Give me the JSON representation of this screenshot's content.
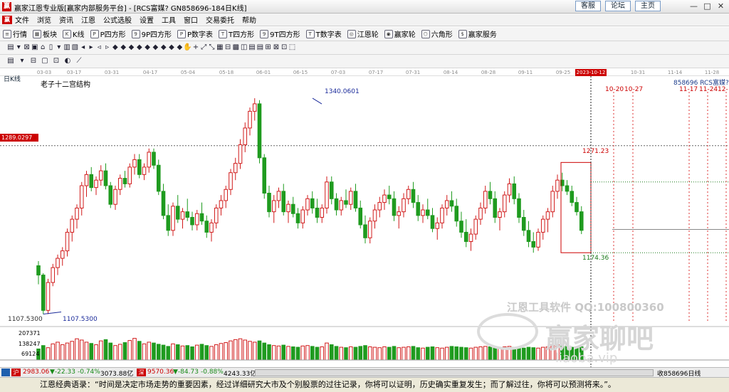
{
  "window": {
    "title": "赢家江恩专业版[赢家内部服务平台] - [RCS富媒?  GN858696-184日K线]",
    "links": [
      "客服",
      "论坛",
      "主页"
    ],
    "minimize_glyph": "—",
    "restore_glyph": "□",
    "close_glyph": "✕"
  },
  "menu": {
    "items": [
      "文件",
      "浏览",
      "资讯",
      "江恩",
      "公式选股",
      "设置",
      "工具",
      "窗口",
      "交易委托",
      "帮助"
    ]
  },
  "toolbar": {
    "items": [
      {
        "label": "行情",
        "icon": "grid-icon",
        "glyph": "≡"
      },
      {
        "label": "板块",
        "icon": "blocks-icon",
        "glyph": "▦"
      },
      {
        "label": "K线",
        "icon": "candle-icon",
        "glyph": "K"
      },
      {
        "label": "P四方形",
        "icon": "p-square-icon",
        "glyph": "P"
      },
      {
        "label": "9P四方形",
        "icon": "9p-square-icon",
        "glyph": "9"
      },
      {
        "label": "P数字表",
        "icon": "p-table-icon",
        "glyph": "P"
      },
      {
        "label": "T四方形",
        "icon": "t-square-icon",
        "glyph": "T"
      },
      {
        "label": "9T四方形",
        "icon": "9t-square-icon",
        "glyph": "9"
      },
      {
        "label": "T数字表",
        "icon": "t-table-icon",
        "glyph": "T"
      },
      {
        "label": "江恩轮",
        "icon": "gann-wheel-icon",
        "glyph": "◎"
      },
      {
        "label": "赢家轮",
        "icon": "winner-wheel-icon",
        "glyph": "◉"
      },
      {
        "label": "六角形",
        "icon": "hexagon-icon",
        "glyph": "⬡"
      },
      {
        "label": "赢家服务",
        "icon": "service-icon",
        "glyph": "$"
      }
    ],
    "row2_glyphs": [
      "▤",
      "▾",
      "⊠",
      "▣",
      "⌂",
      "▯",
      "▾",
      "▥",
      "▧",
      "◂",
      "▸",
      "◃",
      "▹",
      "◆",
      "◆",
      "◆",
      "◆",
      "◆",
      "◆",
      "◆",
      "◆",
      "◆",
      "✋",
      "+",
      "⤢",
      "⤡",
      "▦",
      "⊟",
      "▩",
      "◫",
      "▤",
      "▤",
      "⊞",
      "⊠",
      "⊡",
      "⬚"
    ],
    "row3_glyphs": [
      "▤",
      "▾",
      "⊟",
      "▢",
      "⊡",
      "◐",
      "⟋"
    ]
  },
  "date_axis": {
    "labels": [
      "03-03",
      "03-17",
      "03-31",
      "04-17",
      "05-04",
      "05-18",
      "06-01",
      "06-15",
      "07-03",
      "07-17",
      "07-31",
      "08-14",
      "08-28",
      "09-11",
      "09-25",
      "10-31",
      "11-14",
      "11-28"
    ],
    "highlight": "2023-10-12"
  },
  "chart": {
    "period_label": "日K线",
    "indicator_label": "老子十二宫结构",
    "symbol_label": "858696  RCS富媒?",
    "cursor_price": "1289.0297",
    "low_label_left": "1107.5300",
    "low_annotation": "1107.5300",
    "high_annotation": "1340.0601",
    "box_high": "1271.23",
    "box_low": "1174.36",
    "future_dates_a": [
      "10-20",
      "10-27"
    ],
    "future_dates_b": [
      "11-17",
      "11-24",
      "12-"
    ],
    "up_color": "#d11b1b",
    "down_color": "#1f9b1f"
  },
  "volume": {
    "labels": [
      "207371",
      "138247",
      "69124"
    ]
  },
  "chart_data": {
    "type": "candlestick",
    "title": "老子十二宫结构",
    "xlabel": "",
    "ylabel": "",
    "ylim": [
      1100,
      1350
    ],
    "candles": [
      [
        1160,
        1165,
        1140,
        1150
      ],
      [
        1150,
        1152,
        1108,
        1112
      ],
      [
        1112,
        1146,
        1108,
        1142
      ],
      [
        1142,
        1162,
        1138,
        1158
      ],
      [
        1158,
        1172,
        1150,
        1168
      ],
      [
        1168,
        1180,
        1160,
        1176
      ],
      [
        1176,
        1200,
        1170,
        1196
      ],
      [
        1196,
        1214,
        1186,
        1210
      ],
      [
        1210,
        1226,
        1200,
        1222
      ],
      [
        1222,
        1250,
        1214,
        1246
      ],
      [
        1246,
        1262,
        1234,
        1258
      ],
      [
        1258,
        1266,
        1240,
        1244
      ],
      [
        1244,
        1256,
        1236,
        1252
      ],
      [
        1252,
        1268,
        1246,
        1262
      ],
      [
        1262,
        1270,
        1242,
        1246
      ],
      [
        1246,
        1250,
        1222,
        1226
      ],
      [
        1226,
        1246,
        1220,
        1242
      ],
      [
        1242,
        1258,
        1236,
        1254
      ],
      [
        1254,
        1262,
        1244,
        1248
      ],
      [
        1248,
        1270,
        1244,
        1266
      ],
      [
        1266,
        1280,
        1258,
        1274
      ],
      [
        1274,
        1280,
        1254,
        1258
      ],
      [
        1258,
        1270,
        1252,
        1266
      ],
      [
        1266,
        1286,
        1260,
        1282
      ],
      [
        1282,
        1286,
        1264,
        1268
      ],
      [
        1268,
        1274,
        1236,
        1240
      ],
      [
        1240,
        1248,
        1210,
        1214
      ],
      [
        1214,
        1226,
        1192,
        1198
      ],
      [
        1198,
        1228,
        1192,
        1224
      ],
      [
        1224,
        1236,
        1206,
        1210
      ],
      [
        1210,
        1222,
        1200,
        1218
      ],
      [
        1218,
        1232,
        1208,
        1212
      ],
      [
        1212,
        1218,
        1198,
        1204
      ],
      [
        1204,
        1220,
        1198,
        1216
      ],
      [
        1216,
        1228,
        1204,
        1208
      ],
      [
        1208,
        1214,
        1190,
        1196
      ],
      [
        1196,
        1210,
        1186,
        1206
      ],
      [
        1206,
        1226,
        1200,
        1222
      ],
      [
        1222,
        1236,
        1214,
        1230
      ],
      [
        1230,
        1246,
        1222,
        1242
      ],
      [
        1242,
        1264,
        1236,
        1260
      ],
      [
        1260,
        1276,
        1252,
        1270
      ],
      [
        1270,
        1296,
        1264,
        1290
      ],
      [
        1290,
        1314,
        1282,
        1308
      ],
      [
        1308,
        1330,
        1300,
        1326
      ],
      [
        1326,
        1340,
        1316,
        1334
      ],
      [
        1334,
        1338,
        1270,
        1276
      ],
      [
        1276,
        1280,
        1232,
        1238
      ],
      [
        1238,
        1246,
        1212,
        1218
      ],
      [
        1218,
        1236,
        1206,
        1230
      ],
      [
        1230,
        1244,
        1222,
        1240
      ],
      [
        1240,
        1248,
        1214,
        1218
      ],
      [
        1218,
        1230,
        1206,
        1226
      ],
      [
        1226,
        1234,
        1212,
        1216
      ],
      [
        1216,
        1222,
        1200,
        1206
      ],
      [
        1206,
        1224,
        1200,
        1220
      ],
      [
        1220,
        1236,
        1214,
        1232
      ],
      [
        1232,
        1240,
        1216,
        1222
      ],
      [
        1222,
        1232,
        1206,
        1212
      ],
      [
        1212,
        1226,
        1206,
        1222
      ],
      [
        1222,
        1256,
        1216,
        1250
      ],
      [
        1250,
        1256,
        1226,
        1232
      ],
      [
        1232,
        1238,
        1214,
        1220
      ],
      [
        1220,
        1234,
        1214,
        1230
      ],
      [
        1230,
        1242,
        1222,
        1226
      ],
      [
        1226,
        1244,
        1220,
        1240
      ],
      [
        1240,
        1248,
        1218,
        1222
      ],
      [
        1222,
        1230,
        1200,
        1204
      ],
      [
        1204,
        1214,
        1184,
        1190
      ],
      [
        1190,
        1212,
        1184,
        1208
      ],
      [
        1208,
        1226,
        1200,
        1220
      ],
      [
        1220,
        1234,
        1212,
        1228
      ],
      [
        1228,
        1242,
        1220,
        1236
      ],
      [
        1236,
        1246,
        1226,
        1232
      ],
      [
        1232,
        1240,
        1208,
        1214
      ],
      [
        1214,
        1224,
        1200,
        1218
      ],
      [
        1218,
        1238,
        1212,
        1232
      ],
      [
        1232,
        1246,
        1226,
        1242
      ],
      [
        1242,
        1250,
        1222,
        1228
      ],
      [
        1228,
        1236,
        1208,
        1214
      ],
      [
        1214,
        1226,
        1206,
        1220
      ],
      [
        1220,
        1232,
        1210,
        1214
      ],
      [
        1214,
        1222,
        1196,
        1200
      ],
      [
        1200,
        1212,
        1188,
        1206
      ],
      [
        1206,
        1226,
        1200,
        1222
      ],
      [
        1222,
        1236,
        1214,
        1230
      ],
      [
        1230,
        1240,
        1218,
        1224
      ],
      [
        1224,
        1232,
        1202,
        1208
      ],
      [
        1208,
        1218,
        1190,
        1196
      ],
      [
        1196,
        1210,
        1180,
        1186
      ],
      [
        1186,
        1200,
        1176,
        1194
      ],
      [
        1194,
        1214,
        1188,
        1210
      ],
      [
        1210,
        1228,
        1204,
        1222
      ],
      [
        1222,
        1246,
        1216,
        1240
      ],
      [
        1240,
        1250,
        1226,
        1232
      ],
      [
        1232,
        1240,
        1206,
        1212
      ],
      [
        1212,
        1222,
        1198,
        1218
      ],
      [
        1218,
        1240,
        1212,
        1236
      ],
      [
        1236,
        1254,
        1228,
        1248
      ],
      [
        1248,
        1256,
        1226,
        1232
      ],
      [
        1232,
        1238,
        1206,
        1212
      ],
      [
        1212,
        1220,
        1192,
        1198
      ],
      [
        1198,
        1208,
        1180,
        1186
      ],
      [
        1186,
        1196,
        1174,
        1180
      ],
      [
        1180,
        1200,
        1176,
        1196
      ],
      [
        1196,
        1214,
        1188,
        1210
      ],
      [
        1210,
        1222,
        1196,
        1218
      ],
      [
        1218,
        1246,
        1212,
        1240
      ],
      [
        1240,
        1258,
        1232,
        1252
      ],
      [
        1252,
        1260,
        1240,
        1246
      ],
      [
        1246,
        1252,
        1236,
        1240
      ],
      [
        1240,
        1246,
        1224,
        1228
      ],
      [
        1228,
        1234,
        1214,
        1218
      ],
      [
        1218,
        1224,
        1194,
        1198
      ]
    ],
    "volume": [
      80000,
      120000,
      95000,
      140000,
      160000,
      130000,
      150000,
      170000,
      200000,
      185000,
      160000,
      145000,
      130000,
      175000,
      190000,
      150000,
      120000,
      135000,
      155000,
      180000,
      205000,
      170000,
      140000,
      160000,
      150000,
      135000,
      125000,
      110000,
      140000,
      130000,
      115000,
      120000,
      105000,
      125000,
      135000,
      120000,
      110000,
      130000,
      145000,
      155000,
      175000,
      190000,
      200000,
      185000,
      170000,
      160000,
      175000,
      150000,
      130000,
      120000,
      115000,
      125000,
      110000,
      105000,
      100000,
      115000,
      120000,
      110000,
      100000,
      105000,
      150000,
      130000,
      110000,
      100000,
      95000,
      105000,
      100000,
      110000,
      120000,
      105000,
      100000,
      95000,
      105000,
      100000,
      110000,
      95000,
      100000,
      105000,
      110000,
      95000,
      90000,
      100000,
      105000,
      95000,
      90000,
      100000,
      110000,
      105000,
      100000,
      95000,
      90000,
      100000,
      105000,
      110000,
      105000,
      100000,
      95000,
      105000,
      110000,
      100000,
      95000,
      90000,
      100000,
      95000,
      90000,
      100000,
      105000,
      120000,
      130000,
      110000,
      115000,
      100000,
      95000,
      105000
    ]
  },
  "status_bar": {
    "index1": {
      "code": "沪",
      "value": "2983.06",
      "change": "▼-22.33",
      "percent": "-0.74%",
      "amount": "3073.88亿"
    },
    "index2": {
      "code": "深",
      "value": "9570.36",
      "change": "▼-84.73",
      "percent": "-0.88%",
      "amount": "4243.33亿"
    },
    "right_text": "收858696日线"
  },
  "quote": "江恩经典语录：“时间是决定市场走势的重要因素，经过详细研究大市及个别股票的过往记录，你将可以证明，历史确实重复发生；而了解过往，你将可以预测将来。”。",
  "watermark": {
    "line1": "江恩工具软件   QQ:100800360",
    "line2": "赢家聊吧",
    "line3": "liaoba.vip"
  }
}
